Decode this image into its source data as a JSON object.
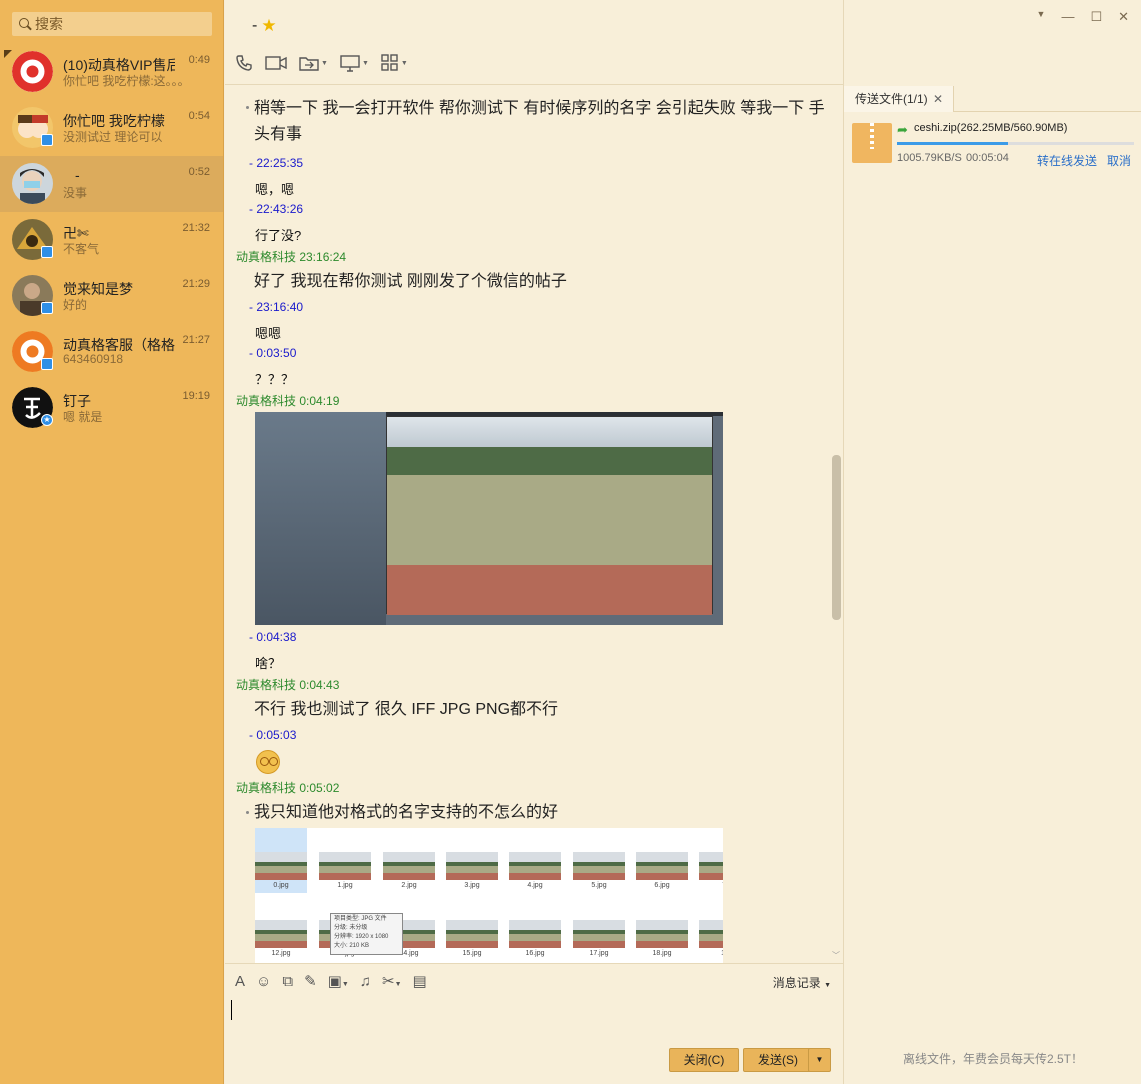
{
  "search": {
    "placeholder": "搜索"
  },
  "conversations": [
    {
      "name": "(10)动真格VIP售后",
      "time": "0:49",
      "preview": "你忙吧 我吃柠檬:这。。。"
    },
    {
      "name": "你忙吧 我吃柠檬",
      "time": "0:54",
      "preview": "没测试过 理论可以"
    },
    {
      "name": "-",
      "time": "0:52",
      "preview": "没事"
    },
    {
      "name": "卍✄",
      "time": "21:32",
      "preview": "不客气"
    },
    {
      "name": "觉来知是梦",
      "time": "21:29",
      "preview": "好的"
    },
    {
      "name": "动真格客服（格格",
      "time": "21:27",
      "preview": "643460918"
    },
    {
      "name": "钉子",
      "time": "19:19",
      "preview": "嗯 就是"
    }
  ],
  "chat": {
    "title": "-",
    "messages": {
      "m1": "稍等一下 我一会打开软件 帮你测试下 有时候序列的名字 会引起失败 等我一下 手头有事",
      "t1": "-   22:25:35",
      "m2": "嗯，嗯",
      "t2": "-   22:43:26",
      "m3": "行了没?",
      "t3": "动真格科技   23:16:24",
      "m4": "好了 我现在帮你测试 刚刚发了个微信的帖子",
      "t4": "-   23:16:40",
      "m5": "嗯嗯",
      "t5": "-   0:03:50",
      "m6": "？？？",
      "t6": "动真格科技   0:04:19",
      "t7": "-   0:04:38",
      "m7": "啥？",
      "t8": "动真格科技   0:04:43",
      "m8": "不行 我也测试了 很久 IFF JPG PNG都不行",
      "t9": "-   0:05:03",
      "t10": "动真格科技   0:05:02",
      "m9": "我只知道他对格式的名字支持的不怎么的好"
    },
    "thumbs_row1": [
      "0.jpg",
      "1.jpg",
      "2.jpg",
      "3.jpg",
      "4.jpg",
      "5.jpg",
      "6.jpg",
      "7."
    ],
    "thumbs_row2": [
      "12.jpg",
      "13.jpg",
      "14.jpg",
      "15.jpg",
      "16.jpg",
      "17.jpg",
      "18.jpg",
      "19"
    ],
    "tooltip": [
      "项目类型: JPG 文件",
      "分级: 未分级",
      "分辨率: 1920 x 1080",
      "大小: 210 KB"
    ],
    "history_label": "消息记录",
    "close_label": "关闭(C)",
    "send_label": "发送(S)"
  },
  "transfer": {
    "tab_label": "传送文件(1/1)",
    "file_name": "ceshi.zip(262.25MB/560.90MB)",
    "progress": 0.47,
    "speed": "1005.79KB/S",
    "remaining": "00:05:04",
    "offline_send": "转在线发送",
    "cancel": "取消",
    "offline_note": "离线文件，年费会员每天传2.5T！"
  },
  "colors": {
    "sidebar": "#eeb75a",
    "accent_blue": "#1a1acc",
    "accent_green": "#2d8a2d"
  }
}
